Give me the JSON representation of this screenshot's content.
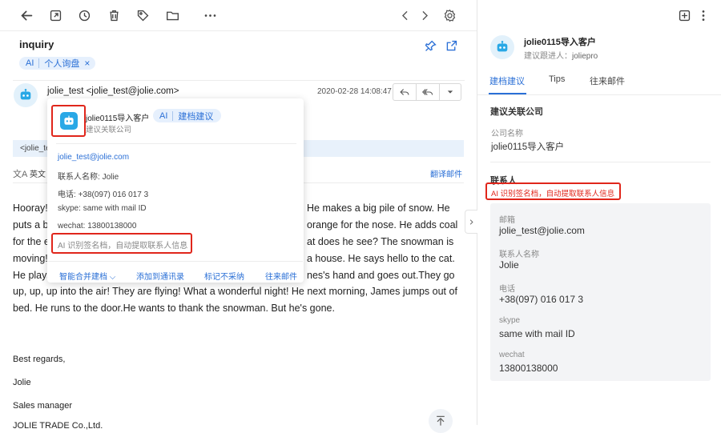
{
  "toolbar": {
    "icons": [
      "back-arrow-icon",
      "external-window-icon",
      "clock-icon",
      "trash-icon",
      "tag-icon",
      "folder-icon",
      "more-icon"
    ],
    "right_icons": [
      "chevron-left-icon",
      "chevron-right-icon",
      "gear-icon"
    ]
  },
  "email": {
    "subject": "inquiry",
    "tags": [
      {
        "ai": "AI",
        "label": "个人询盘"
      }
    ],
    "sender": "jolie_test <jolie_test@jolie.com>",
    "date": "2020-02-28 14:08:47",
    "recipient_prefix": "<jolie_te",
    "language": "英文",
    "translate_link": "翻译邮件",
    "body_lines": [
      "Hooray!",
      "puts a b",
      "for the e",
      "moving!",
      "He plays",
      "up, up, up into the air! They are flying! What a wonderful night! He next morning, James jumps out of",
      "bed. He runs to the door.He wants to thank the snowman. But he's gone."
    ],
    "body_right_lines": [
      "He makes a big pile of snow. He",
      "orange for the nose. He adds coal",
      "at does he see? The snowman is",
      "a house. He says hello to the cat.",
      "nes's hand and goes out.They go"
    ],
    "signature": [
      "Best regards,",
      "Jolie",
      "Sales manager",
      "JOLIE TRADE Co.,Ltd."
    ]
  },
  "popup": {
    "company_name": "jolie0115导入客户",
    "ai_label": "AI",
    "suggest_label": "建档建议",
    "subtitle": "建议关联公司",
    "email": "jolie_test@jolie.com",
    "contact_label": "联系人名称:",
    "contact_value": "Jolie",
    "phone_label": "电话:",
    "phone_value": "+38(097) 016 017 3",
    "skype_label": "skype:",
    "skype_value": "same with mail ID",
    "wechat_label": "wechat:",
    "wechat_value": "13800138000",
    "ai_note": "AI 识别签名档，自动提取联系人信息",
    "actions": [
      "智能合并建档",
      "添加到通讯录",
      "标记不采纳",
      "往来邮件"
    ]
  },
  "right_panel": {
    "company": "jolie0115导入客户",
    "follower_label": "建议跟进人：",
    "follower_value": "joliepro",
    "tabs": [
      "建档建议",
      "Tips",
      "往来邮件"
    ],
    "active_tab": 0,
    "section_company": "建议关联公司",
    "company_name_label": "公司名称",
    "company_name_value": "jolie0115导入客户",
    "section_contact": "联系人",
    "contact_note": "AI 识别签名档，自动提取联系人信息",
    "fields": [
      {
        "label": "邮箱",
        "value": "jolie_test@jolie.com"
      },
      {
        "label": "联系人名称",
        "value": "Jolie"
      },
      {
        "label": "电话",
        "value": "+38(097) 016 017 3"
      },
      {
        "label": "skype",
        "value": "same with mail ID"
      },
      {
        "label": "wechat",
        "value": "13800138000"
      }
    ]
  },
  "colors": {
    "accent": "#2a6fd6",
    "highlight_box": "#e0261b",
    "robot": "#29a8e6"
  }
}
